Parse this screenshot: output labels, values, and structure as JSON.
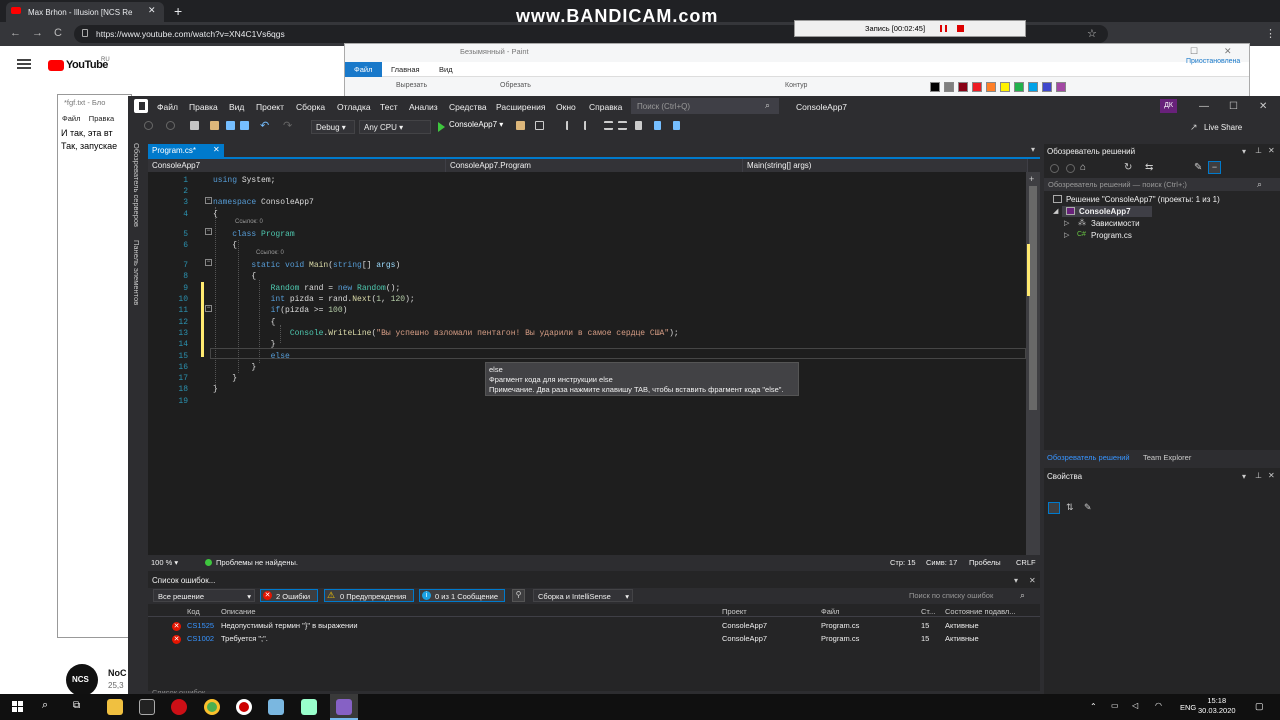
{
  "browser": {
    "tab_title": "Max Brhon - Illusion [NCS Re",
    "tab_close": "✕",
    "new_tab": "+",
    "url": "https://www.youtube.com/watch?v=XN4C1Vs6qgs",
    "nav_back": "←",
    "nav_forward": "→",
    "nav_reload": "C"
  },
  "youtube": {
    "logo_text": "YouTube",
    "logo_region": "RU",
    "channel_avatar_text": "NCS",
    "channel_name": "NoC",
    "channel_subs": "25,3"
  },
  "bandicam": {
    "watermark": "www.BANDICAM.com",
    "recording_label": "Запись [00:02:45]"
  },
  "paint": {
    "title": "Безымянный - Paint",
    "file_tab": "Файл",
    "tabs": [
      "Главная",
      "Вид"
    ],
    "ribbon_items": [
      "Вырезать",
      "Обрезать",
      "Контур"
    ],
    "swatch_colors": [
      "#000000",
      "#7f7f7f",
      "#880015",
      "#ed1c24",
      "#ff7f27",
      "#fff200",
      "#22b14c",
      "#00a2e8",
      "#3f48cc",
      "#a349a4"
    ],
    "user_label": "Приостановлена"
  },
  "notepad": {
    "title": "*fgf.txt - Бло",
    "menu": [
      "Файл",
      "Правка"
    ],
    "lines": [
      "И так, эта вт",
      "Так, запускае"
    ]
  },
  "vs": {
    "menu": [
      "Файл",
      "Правка",
      "Вид",
      "Проект",
      "Сборка",
      "Отладка",
      "Тест",
      "Анализ",
      "Средства",
      "Расширения",
      "Окно",
      "Справка"
    ],
    "search_placeholder": "Поиск (Ctrl+Q)",
    "project_name": "ConsoleApp7",
    "user_initials": "ДК",
    "config": "Debug",
    "platform": "Any CPU",
    "run_label": "ConsoleApp7",
    "live_share": "Live Share",
    "left_tabs": [
      "Обозреватель серверов",
      "Панель элементов"
    ],
    "doc_tab": "Program.cs*",
    "nav_project": "ConsoleApp7",
    "nav_class": "ConsoleApp7.Program",
    "nav_member": "Main(string[] args)",
    "ref_label": "Ссылок: 0",
    "code_lines": [
      [
        {
          "t": "using ",
          "c": "kw"
        },
        {
          "t": "System;",
          "c": ""
        }
      ],
      [],
      [
        {
          "t": "namespace ",
          "c": "kw"
        },
        {
          "t": "ConsoleApp7",
          "c": ""
        }
      ],
      [
        {
          "t": "{",
          "c": ""
        }
      ],
      [
        {
          "t": "    class ",
          "c": "kw"
        },
        {
          "t": "Program",
          "c": "ty"
        }
      ],
      [
        {
          "t": "    {",
          "c": ""
        }
      ],
      [
        {
          "t": "        static void ",
          "c": "kw"
        },
        {
          "t": "Main",
          "c": "me"
        },
        {
          "t": "(",
          "c": ""
        },
        {
          "t": "string",
          "c": "kw"
        },
        {
          "t": "[] ",
          "c": ""
        },
        {
          "t": "args",
          "c": "pa"
        },
        {
          "t": ")",
          "c": ""
        }
      ],
      [
        {
          "t": "        {",
          "c": ""
        }
      ],
      [
        {
          "t": "            ",
          "c": ""
        },
        {
          "t": "Random",
          "c": "ty"
        },
        {
          "t": " rand = ",
          "c": ""
        },
        {
          "t": "new ",
          "c": "kw"
        },
        {
          "t": "Random",
          "c": "ty"
        },
        {
          "t": "();",
          "c": ""
        }
      ],
      [
        {
          "t": "            ",
          "c": ""
        },
        {
          "t": "int ",
          "c": "kw"
        },
        {
          "t": "pizda = rand.",
          "c": ""
        },
        {
          "t": "Next",
          "c": "me"
        },
        {
          "t": "(",
          "c": ""
        },
        {
          "t": "1",
          "c": "nu"
        },
        {
          "t": ", ",
          "c": ""
        },
        {
          "t": "120",
          "c": "nu"
        },
        {
          "t": ");",
          "c": ""
        }
      ],
      [
        {
          "t": "            ",
          "c": ""
        },
        {
          "t": "if",
          "c": "kw"
        },
        {
          "t": "(pizda >= ",
          "c": ""
        },
        {
          "t": "100",
          "c": "nu"
        },
        {
          "t": ")",
          "c": ""
        }
      ],
      [
        {
          "t": "            {",
          "c": ""
        }
      ],
      [
        {
          "t": "                ",
          "c": ""
        },
        {
          "t": "Console",
          "c": "ty"
        },
        {
          "t": ".",
          "c": ""
        },
        {
          "t": "WriteLine",
          "c": "me"
        },
        {
          "t": "(",
          "c": ""
        },
        {
          "t": "\"Вы успешно взломали пентагон! Вы ударили в самое сердце США\"",
          "c": "st"
        },
        {
          "t": ");",
          "c": ""
        }
      ],
      [
        {
          "t": "            }",
          "c": ""
        }
      ],
      [
        {
          "t": "            ",
          "c": ""
        },
        {
          "t": "else",
          "c": "kw"
        }
      ],
      [
        {
          "t": "        }",
          "c": ""
        }
      ],
      [
        {
          "t": "    }",
          "c": ""
        }
      ],
      [
        {
          "t": "}",
          "c": ""
        }
      ],
      []
    ],
    "tooltip": {
      "line1": "else",
      "line2": "Фрагмент кода для инструкции else",
      "line3": "Примечание. Два раза нажмите клавишу TAB, чтобы вставить фрагмент кода \"else\"."
    },
    "status": {
      "zoom": "100 %",
      "problems": "Проблемы не найдены.",
      "line": "Стр: 15",
      "col": "Симв: 17",
      "spaces": "Пробелы",
      "eol": "CRLF"
    },
    "error_list": {
      "title": "Список ошибок...",
      "scope": "Все решение",
      "errors_btn": "2 Ошибки",
      "warnings_btn": "0 Предупреждения",
      "messages_btn": "0 из 1 Сообщение",
      "build_filter": "Сборка и IntelliSense",
      "search_placeholder": "Поиск по списку ошибок",
      "headers": [
        "Код",
        "Описание",
        "Проект",
        "Файл",
        "Ст...",
        "Состояние подавл..."
      ],
      "rows": [
        {
          "code": "CS1525",
          "desc": "Недопустимый термин \"}\" в выражении",
          "project": "ConsoleApp7",
          "file": "Program.cs",
          "line": "15",
          "state": "Активные"
        },
        {
          "code": "CS1002",
          "desc": "Требуется \";\".",
          "project": "ConsoleApp7",
          "file": "Program.cs",
          "line": "15",
          "state": "Активные"
        }
      ]
    },
    "solution": {
      "title": "Обозреватель решений",
      "search_placeholder": "Обозреватель решений — поиск (Ctrl+;)",
      "solution_label": "Решение \"ConsoleApp7\" (проекты: 1 из 1)",
      "project": "ConsoleApp7",
      "dependencies": "Зависимости",
      "file": "Program.cs",
      "tabs": [
        "Обозреватель решений",
        "Team Explorer"
      ],
      "properties_title": "Свойства"
    }
  },
  "taskbar": {
    "lang": "ENG",
    "time": "15:18",
    "date": "30.03.2020"
  }
}
